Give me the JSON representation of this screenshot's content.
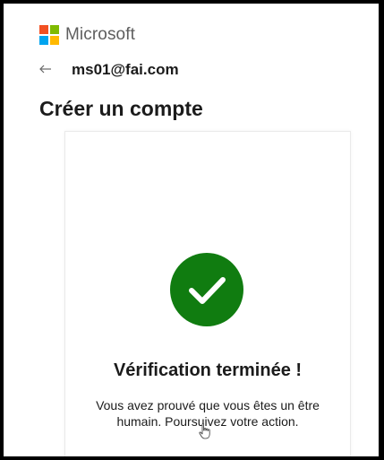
{
  "header": {
    "brand_name": "Microsoft",
    "logo_colors": [
      "#f25022",
      "#7fba00",
      "#00a4ef",
      "#ffb900"
    ]
  },
  "identity": {
    "back_icon": "back-arrow-icon",
    "email": "ms01@fai.com"
  },
  "page": {
    "title": "Créer un compte"
  },
  "verification": {
    "status_icon": "checkmark-icon",
    "status_color": "#107c10",
    "title": "Vérification terminée !",
    "message": "Vous avez prouvé que vous êtes un être humain. Poursuivez votre action."
  },
  "pointer": {
    "icon": "hand-pointer-icon"
  }
}
